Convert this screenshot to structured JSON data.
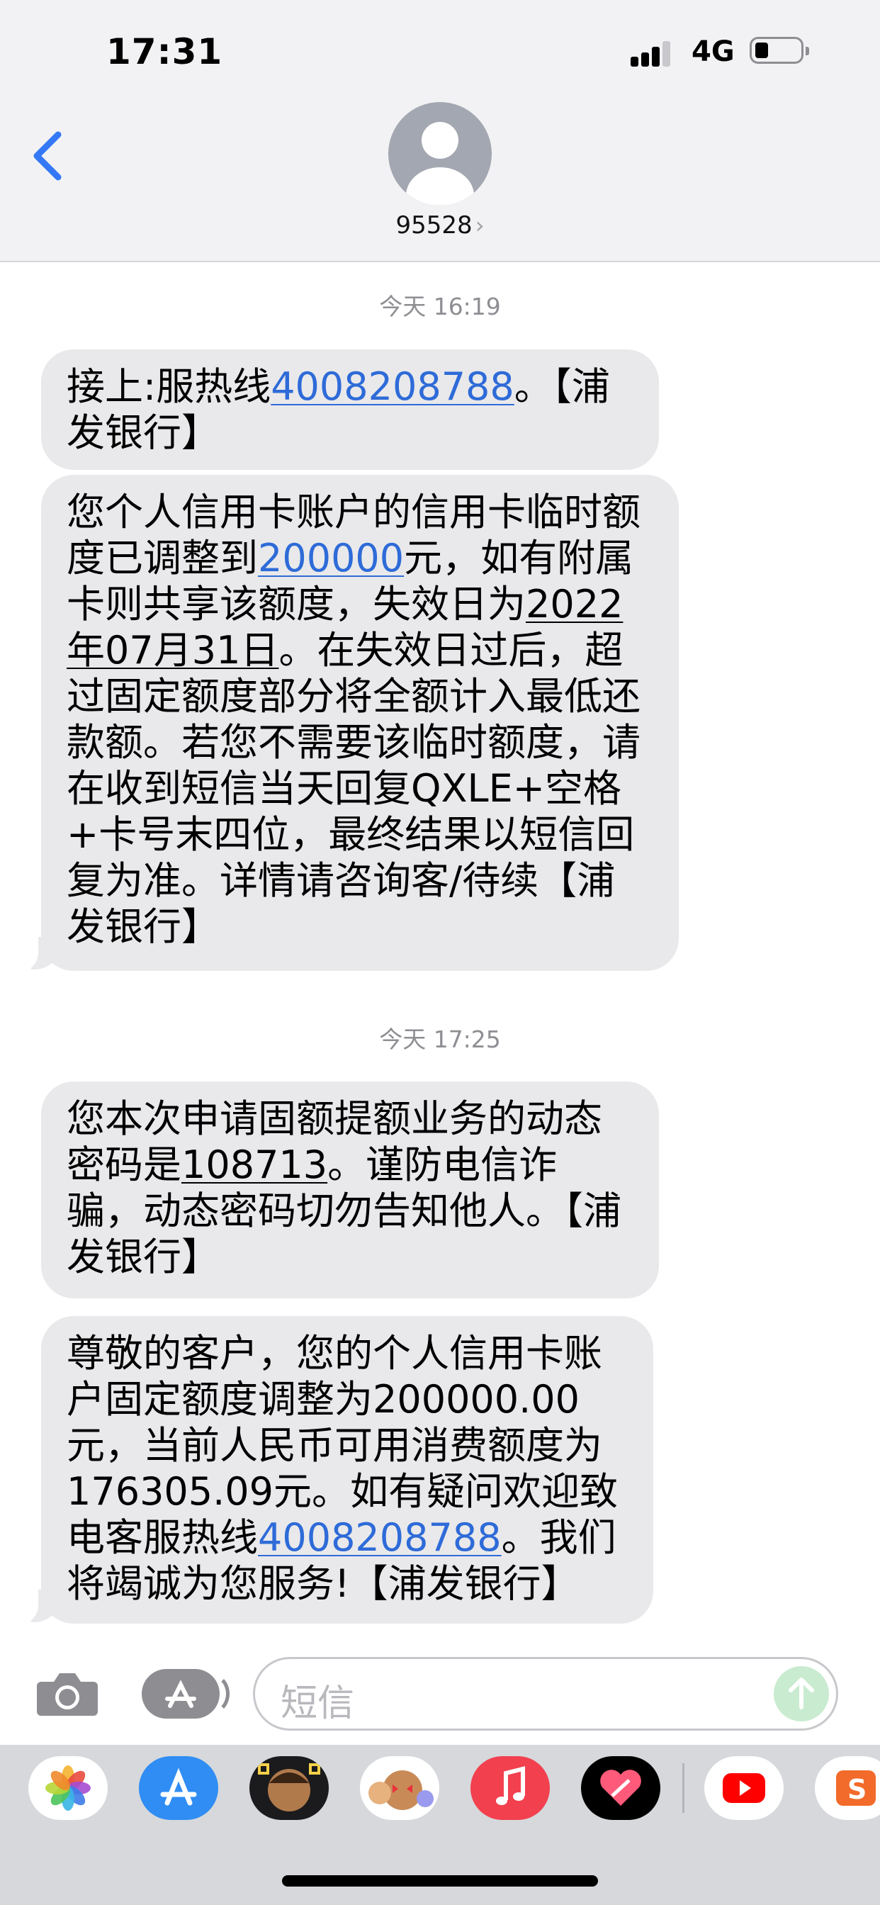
{
  "status_bar": {
    "time": "17:31",
    "network": "4G"
  },
  "header": {
    "contact": "95528",
    "chevron": "›"
  },
  "thread": [
    {
      "timestamp": "今天 16:19"
    },
    {
      "timestamp": "今天 17:25"
    }
  ],
  "messages": {
    "m1": {
      "a": "接上:服热线",
      "phone": "4008208788",
      "b": "。【浦发银行】"
    },
    "m2": {
      "a": "您个人信用卡账户的信用卡临时额度已调整到",
      "amount": "200000",
      "b": "元，如有附属卡则共享该额度，失效日为",
      "date": "2022年07月31日",
      "c": "。在失效日过后，超过固定额度部分将全额计入最低还款额。若您不需要该临时额度，请在收到短信当天回复QXLE+空格+卡号末四位，最终结果以短信回复为准。详情请咨询客/待续【浦发银行】"
    },
    "m3": {
      "a": "您本次申请固额提额业务的动态密码是",
      "code": "108713",
      "b": "。谨防电信诈骗，动态密码切勿告知他人。【浦发银行】"
    },
    "m4": {
      "a": "尊敬的客户，您的个人信用卡账户固定额度调整为200000.00元，当前人民币可用消费额度为176305.09元。如有疑问欢迎致电客服热线",
      "phone": "4008208788",
      "b": "。我们将竭诚为您服务!【浦发银行】"
    }
  },
  "compose": {
    "placeholder": "短信"
  },
  "app_drawer": {
    "apps": [
      "photos-icon",
      "app-store-icon",
      "memoji-icon",
      "memoji-stickers-icon",
      "music-icon",
      "digital-touch-icon",
      "youtube-icon",
      "sogou-icon"
    ]
  },
  "colors": {
    "link": "#2e6bd8",
    "bubble": "#e9e9eb",
    "accent": "#3478f6",
    "send": "#c9ebd0"
  }
}
